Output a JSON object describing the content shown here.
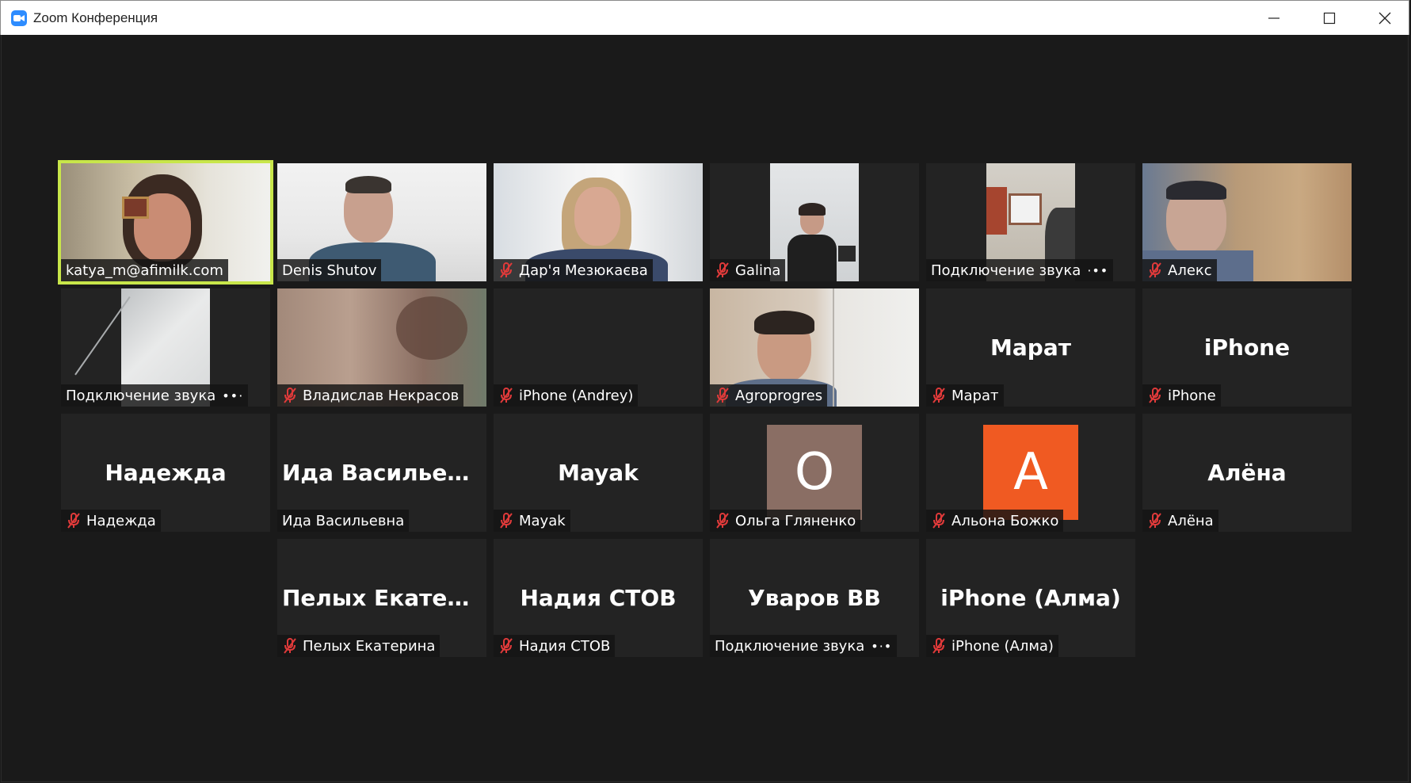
{
  "window": {
    "title": "Zoom Конференция"
  },
  "colors": {
    "active_speaker_border": "#c8e64a",
    "avatar_o": "#8a6e64",
    "avatar_a": "#f05a22"
  },
  "participants": [
    {
      "label": "katya_m@afimilk.com",
      "muted": false,
      "kind": "video"
    },
    {
      "label": "Denis Shutov",
      "muted": false,
      "kind": "video"
    },
    {
      "label": "Дар'я Мезюкаєва",
      "muted": true,
      "kind": "video"
    },
    {
      "label": "Galina",
      "muted": true,
      "kind": "video"
    },
    {
      "label": "Подключение звука",
      "muted": false,
      "kind": "video"
    },
    {
      "label": "Алекс",
      "muted": true,
      "kind": "video"
    },
    {
      "label": "Подключение звука",
      "muted": false,
      "kind": "video"
    },
    {
      "label": "Владислав Некрасов",
      "muted": true,
      "kind": "video"
    },
    {
      "label": "iPhone (Andrey)",
      "muted": true,
      "kind": "blank"
    },
    {
      "label": "Agroprogres",
      "muted": true,
      "kind": "video"
    },
    {
      "label": "Марат",
      "muted": true,
      "kind": "name",
      "display": "Марат"
    },
    {
      "label": "iPhone",
      "muted": true,
      "kind": "name",
      "display": "iPhone"
    },
    {
      "label": "Надежда",
      "muted": true,
      "kind": "name",
      "display": "Надежда"
    },
    {
      "label": "Ида Васильевна",
      "muted": false,
      "kind": "name",
      "display": "Ида Васильевна"
    },
    {
      "label": "Mayak",
      "muted": true,
      "kind": "name",
      "display": "Mayak"
    },
    {
      "label": "Ольга Гляненко",
      "muted": true,
      "kind": "avatar",
      "display": "O"
    },
    {
      "label": "Альона Божко",
      "muted": true,
      "kind": "avatar",
      "display": "A"
    },
    {
      "label": "Алёна",
      "muted": true,
      "kind": "name",
      "display": "Алёна"
    },
    {
      "label": "Пелых Екатерина",
      "muted": true,
      "kind": "name",
      "display": "Пелых  Екатери..."
    },
    {
      "label": "Надия СТОВ",
      "muted": true,
      "kind": "name",
      "display": "Надия СТОВ"
    },
    {
      "label": "Подключение звука",
      "muted": false,
      "kind": "name",
      "display": "Уваров ВВ"
    },
    {
      "label": "iPhone (Алма)",
      "muted": true,
      "kind": "name",
      "display": "iPhone (Алма)"
    }
  ]
}
